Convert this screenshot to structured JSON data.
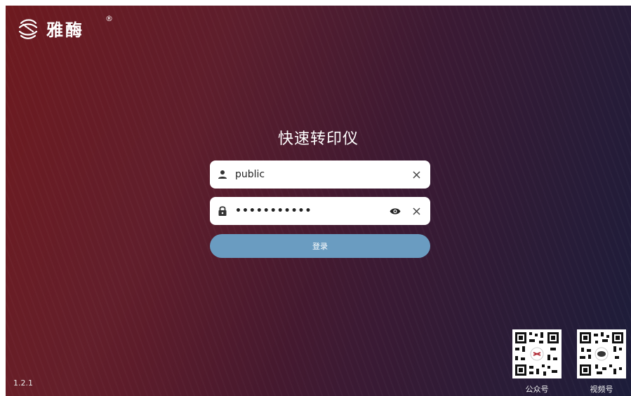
{
  "brand": {
    "name": "雅酶",
    "reg": "®"
  },
  "title": "快速转印仪",
  "username": {
    "value": "public"
  },
  "password": {
    "value": "•••••••••••"
  },
  "login": {
    "label": "登录"
  },
  "version": "1.2.1",
  "qrcodes": [
    {
      "caption": "公众号"
    },
    {
      "caption": "视频号"
    }
  ],
  "colors": {
    "login_button": "#6a9cc1",
    "background_left": "#6e1a1f",
    "background_right": "#1c1d3a"
  }
}
